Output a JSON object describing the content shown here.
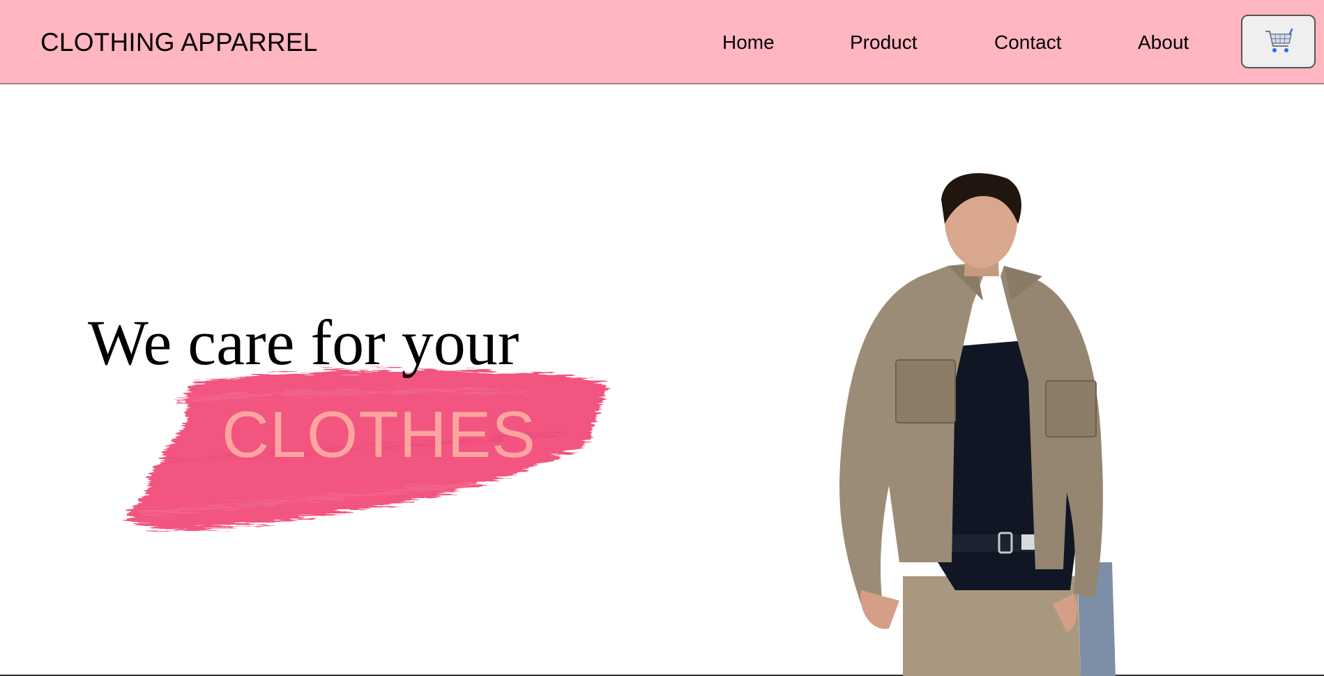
{
  "header": {
    "brand": "CLOTHING APPARREL",
    "nav": {
      "home": "Home",
      "product": "Product",
      "contact": "Contact",
      "about": "About"
    },
    "cart_icon": "shopping-cart-icon",
    "background_color": "#ffb6c1"
  },
  "hero": {
    "line1": "We care for your",
    "line2": "CLOTHES",
    "accent_color": "#f2557f",
    "line2_color": "#ffa5a0"
  }
}
